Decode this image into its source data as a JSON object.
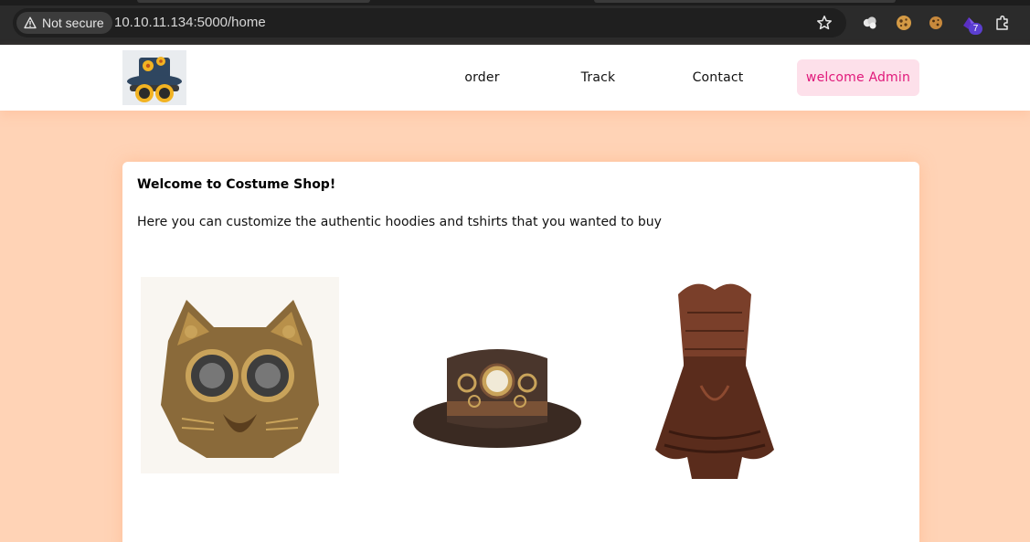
{
  "browser": {
    "security_label": "Not secure",
    "url": "10.10.11.134:5000/home",
    "extension_badge": "7",
    "icons": [
      "warning-icon",
      "star-icon",
      "extension-cloud-icon",
      "cookie-icon",
      "cookie-icon",
      "puzzle-extension-icon"
    ]
  },
  "header": {
    "logo_icon": "steampunk-hat-logo",
    "nav": {
      "order": "order",
      "track": "Track",
      "contact": "Contact",
      "admin": "welcome Admin"
    }
  },
  "main": {
    "title": "Welcome to Costume Shop!",
    "text": "Here you can customize the authentic hoodies and tshirts that you wanted to buy",
    "products": [
      "steampunk-cat-mask-image",
      "steampunk-top-hat-image",
      "steampunk-corset-dress-image"
    ]
  },
  "colors": {
    "page_bg": "#ffd3b6",
    "admin_bg": "#fde0ea",
    "admin_text": "#e0187a"
  }
}
